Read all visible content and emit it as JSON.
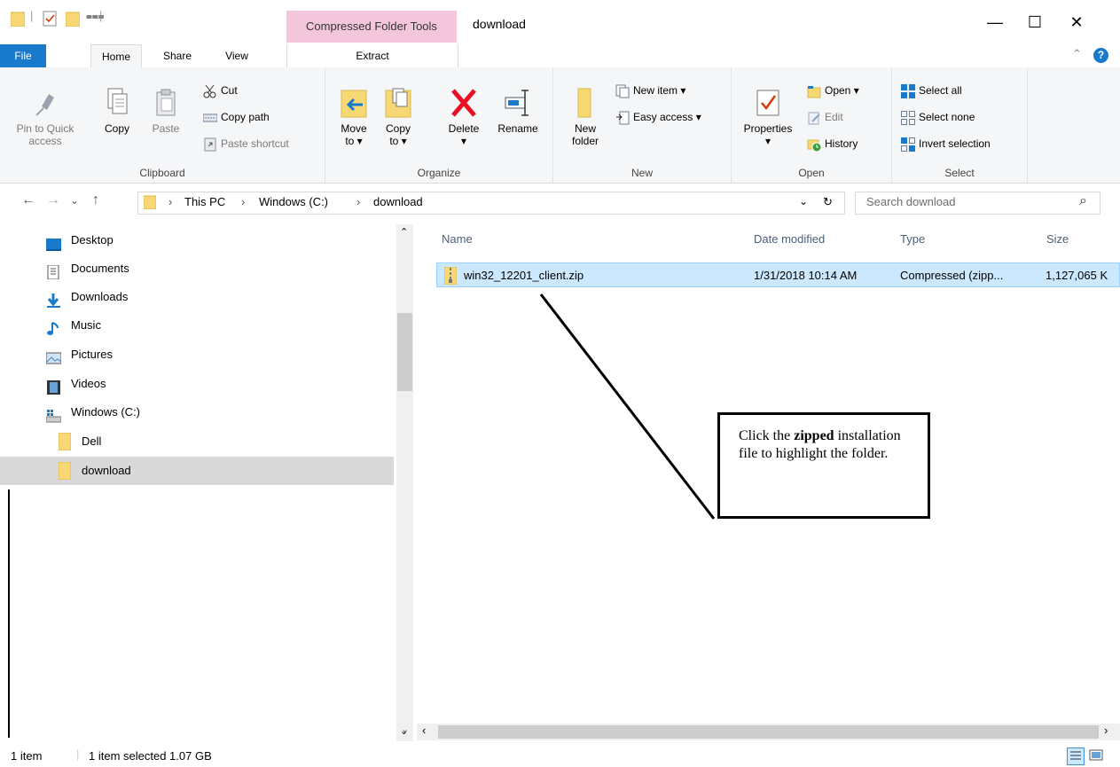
{
  "window": {
    "title": "download",
    "context_tab": "Compressed Folder Tools",
    "minimize": "—",
    "maximize": "☐",
    "close": "✕"
  },
  "tabs": {
    "file": "File",
    "home": "Home",
    "share": "Share",
    "view": "View",
    "extract": "Extract"
  },
  "ribbon": {
    "clipboard": {
      "label": "Clipboard",
      "pin": [
        "Pin to Quick",
        "access"
      ],
      "copy": "Copy",
      "paste": "Paste",
      "cut": "Cut",
      "copy_path": "Copy path",
      "paste_shortcut": "Paste shortcut"
    },
    "organize": {
      "label": "Organize",
      "move_to": [
        "Move",
        "to ▾"
      ],
      "copy_to": [
        "Copy",
        "to ▾"
      ],
      "delete": [
        "Delete",
        "▾"
      ],
      "rename": "Rename"
    },
    "new": {
      "label": "New",
      "new_folder": [
        "New",
        "folder"
      ],
      "new_item": "New item ▾",
      "easy_access": "Easy access ▾"
    },
    "open": {
      "label": "Open",
      "properties": [
        "Properties",
        "▾"
      ],
      "open": "Open ▾",
      "edit": "Edit",
      "history": "History"
    },
    "select": {
      "label": "Select",
      "select_all": "Select all",
      "select_none": "Select none",
      "invert_selection": "Invert selection"
    }
  },
  "address": {
    "back": "←",
    "forward": "→",
    "recent": "⌄",
    "up": "↑",
    "crumbs": [
      "This PC",
      "Windows (C:)",
      "download"
    ],
    "sep": "›",
    "dropdown": "⌄",
    "refresh": "↻",
    "search_placeholder": "Search download",
    "search_icon": "⌕"
  },
  "nav": [
    {
      "label": "Desktop",
      "icon": "desktop-icon"
    },
    {
      "label": "Documents",
      "icon": "documents-icon"
    },
    {
      "label": "Downloads",
      "icon": "downloads-icon"
    },
    {
      "label": "Music",
      "icon": "music-icon"
    },
    {
      "label": "Pictures",
      "icon": "pictures-icon"
    },
    {
      "label": "Videos",
      "icon": "videos-icon"
    },
    {
      "label": "Windows (C:)",
      "icon": "drive-icon"
    },
    {
      "label": "Dell",
      "icon": "folder-icon"
    },
    {
      "label": "download",
      "icon": "folder-icon",
      "selected": true
    }
  ],
  "files": {
    "columns": [
      "Name",
      "Date modified",
      "Type",
      "Size"
    ],
    "rows": [
      {
        "name": "win32_12201_client.zip",
        "date": "1/31/2018 10:14 AM",
        "type": "Compressed (zipp...",
        "size": "1,127,065 K",
        "selected": true
      }
    ]
  },
  "status": {
    "count": "1 item",
    "selected": "1 item selected  1.07 GB"
  },
  "callout": {
    "pre": "Click the ",
    "bold": "zipped",
    "post": " installation file to highlight the folder."
  },
  "colors": {
    "file_tab": "#1979ca",
    "context_tab": "#f4c6dc",
    "selection": "#cce8ff",
    "folder": "#f8d775",
    "delete_red": "#e81123"
  }
}
